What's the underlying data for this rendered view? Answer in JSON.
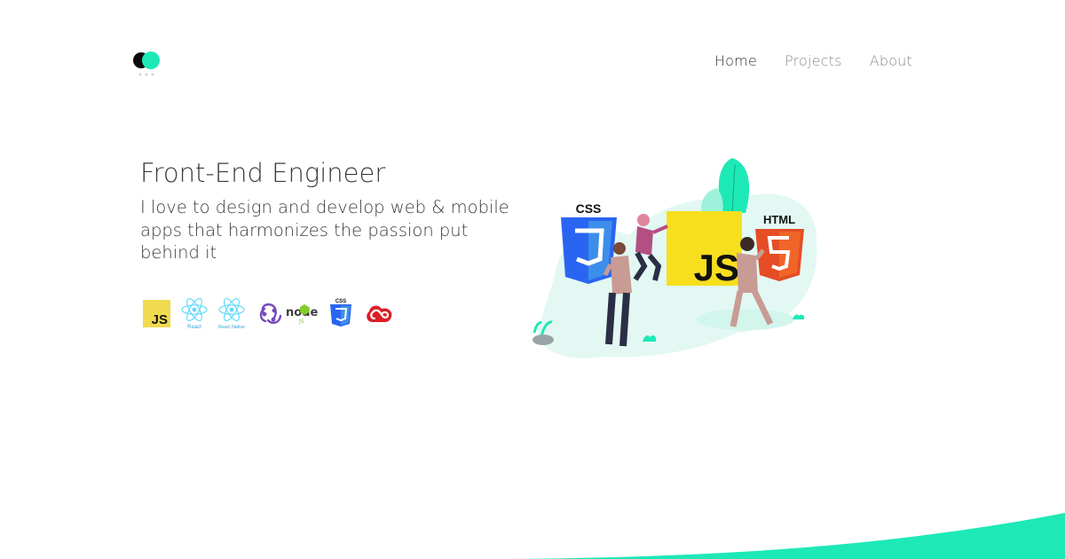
{
  "nav": {
    "items": [
      {
        "label": "Home",
        "active": true
      },
      {
        "label": "Projects",
        "active": false
      },
      {
        "label": "About",
        "active": false
      }
    ]
  },
  "hero": {
    "title": "Front-End Engineer",
    "subtitle": "I love to design and develop web & mobile apps that harmonizes the passion put behind it"
  },
  "tech_stack": {
    "js": "JS",
    "react": "React",
    "react_native": "React Native",
    "node": "node",
    "css": "CSS"
  },
  "illustration": {
    "css_label": "CSS",
    "js_label": "JS",
    "html_label": "HTML"
  },
  "colors": {
    "accent": "#1de9b6",
    "text": "#333333",
    "nav_inactive": "#8a8a8a",
    "js_yellow": "#f0db4f",
    "css_blue": "#2965f1",
    "html_orange": "#e44d26",
    "react_blue": "#61dafb"
  }
}
